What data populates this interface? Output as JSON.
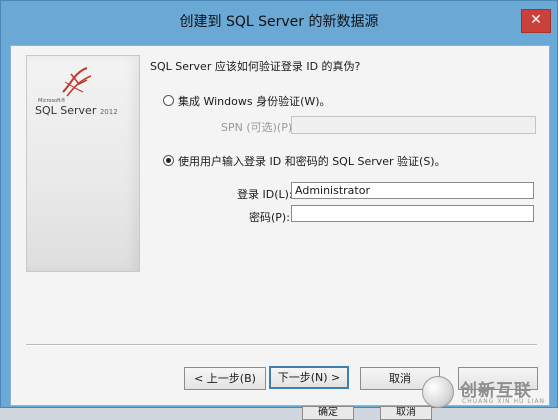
{
  "window": {
    "title": "创建到 SQL Server 的新数据源",
    "close_glyph": "✕"
  },
  "logo": {
    "small": "Microsoft®",
    "main": "SQL Server",
    "year": "2012"
  },
  "auth": {
    "question": "SQL Server 应该如何验证登录 ID 的真伪?",
    "option_windows": "集成 Windows 身份验证(W)。",
    "spn_label": "SPN (可选)(P):",
    "option_sql": "使用用户输入登录 ID 和密码的 SQL Server 验证(S)。",
    "selected": "sql",
    "login_label": "登录 ID(L):",
    "login_value": "Administrator",
    "password_label": "密码(P):",
    "password_value": ""
  },
  "buttons": {
    "back": "< 上一步(B)",
    "next": "下一步(N) >",
    "cancel": "取消",
    "help": ""
  },
  "under": {
    "ok": "确定",
    "cancel": "取消"
  },
  "watermark": {
    "text": "创新互联",
    "sub": "CHUANG XIN HU LIAN"
  }
}
